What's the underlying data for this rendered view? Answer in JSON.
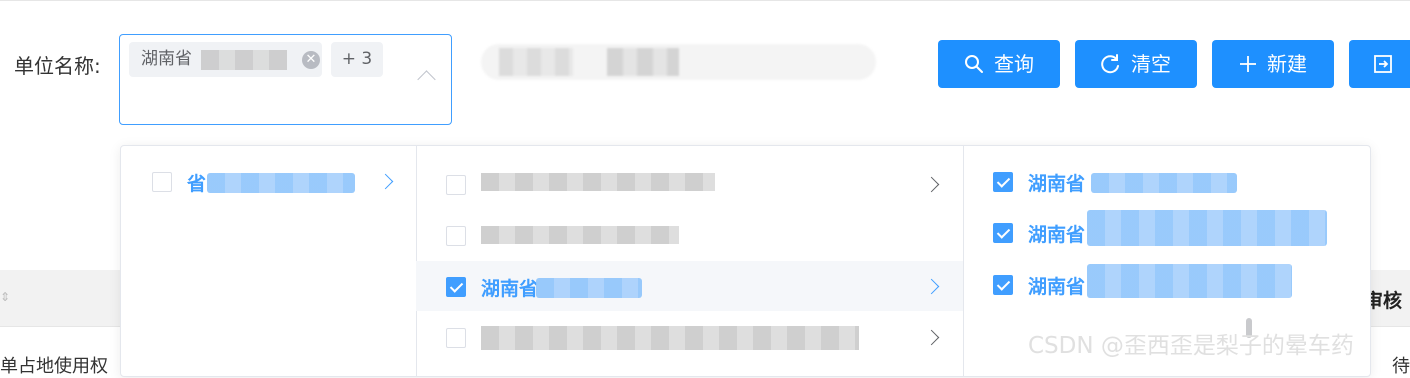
{
  "form": {
    "unit_label": "单位名称:",
    "selected_tag": "湖南省",
    "more_count": "+ 3"
  },
  "buttons": {
    "query": "查询",
    "clear": "清空",
    "new": "新建"
  },
  "cascader": {
    "col1_item": "省",
    "col2_active": "湖南省",
    "col3_items": [
      "湖南省",
      "湖南省",
      "湖南省"
    ]
  },
  "table": {
    "header_right": "审核",
    "row_left": "单占地使用权",
    "row_right": "待"
  },
  "watermark": "CSDN @歪西歪是梨子的晕车药",
  "colors": {
    "primary": "#409eff",
    "button": "#1e90ff"
  }
}
